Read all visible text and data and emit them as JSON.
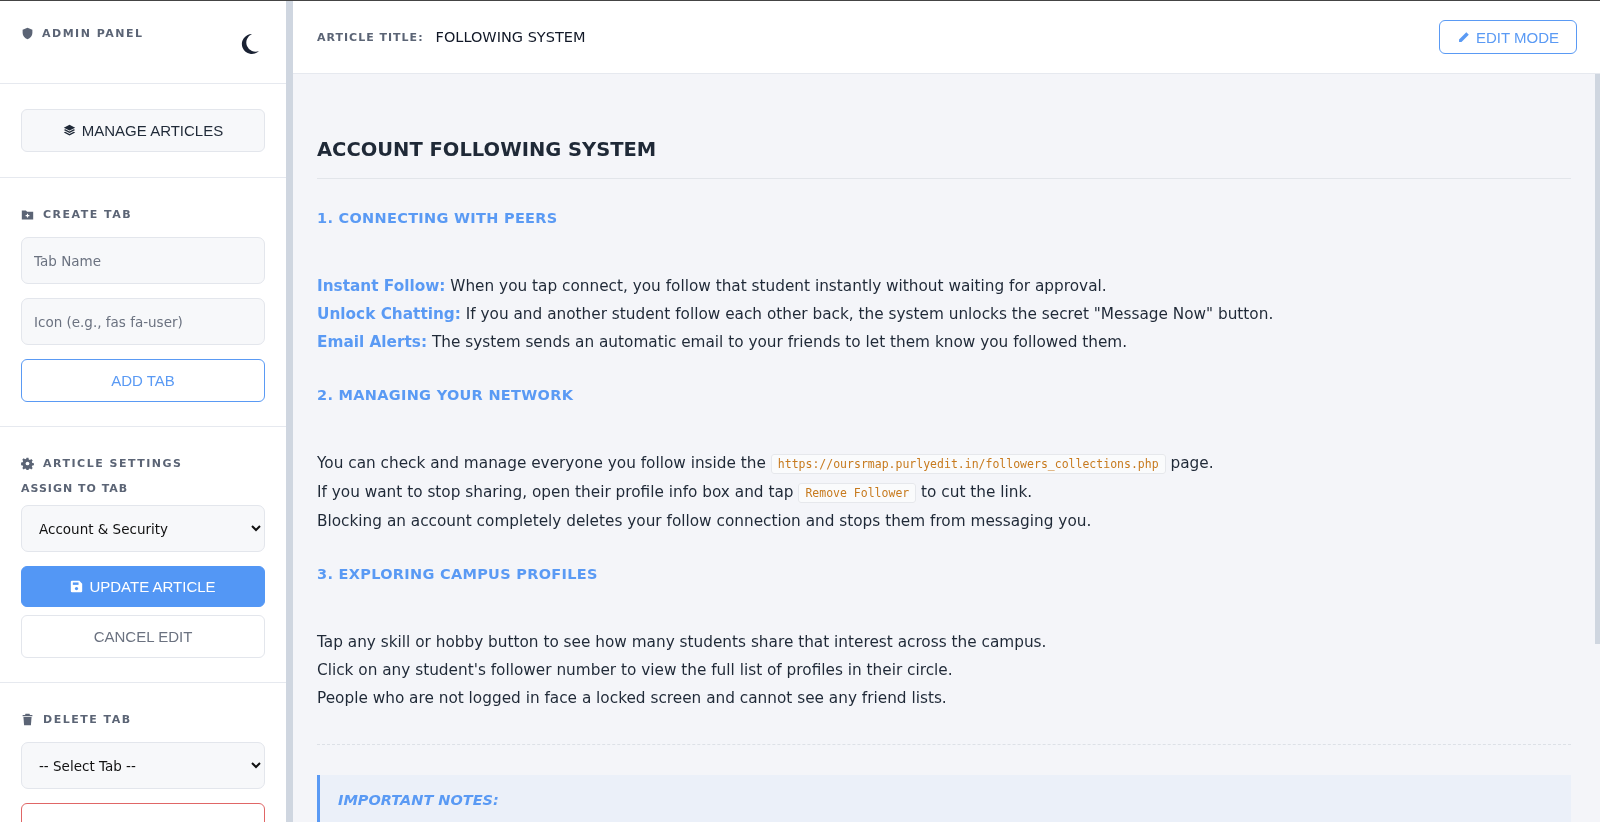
{
  "sidebar": {
    "brand": "ADMIN PANEL",
    "manage_button": "MANAGE ARTICLES",
    "create_tab": {
      "title": "CREATE TAB",
      "fields": [
        {
          "placeholder": "Tab Name"
        },
        {
          "placeholder": "Icon (e.g., fas fa-user)"
        }
      ],
      "button": "ADD TAB"
    },
    "article_settings": {
      "title": "ARTICLE SETTINGS",
      "assign_label": "ASSIGN TO TAB",
      "select_value": "Account & Security",
      "update_button": "UPDATE ARTICLE",
      "cancel_button": "CANCEL EDIT"
    },
    "delete_tab": {
      "title": "DELETE TAB",
      "select_value": "-- Select Tab --"
    }
  },
  "header": {
    "title_label": "ARTICLE TITLE:",
    "title_value": "FOLLOWING SYSTEM",
    "edit_button": "EDIT MODE"
  },
  "article": {
    "title": "ACCOUNT FOLLOWING SYSTEM",
    "sections": [
      {
        "heading": "1. CONNECTING WITH PEERS",
        "lines": [
          [
            {
              "kind": "lead",
              "text": "Instant Follow:"
            },
            {
              "kind": "text",
              "text": " When you tap connect, you follow that student instantly without waiting for approval."
            }
          ],
          [
            {
              "kind": "lead",
              "text": "Unlock Chatting:"
            },
            {
              "kind": "text",
              "text": " If you and another student follow each other back, the system unlocks the secret \"Message Now\" button."
            }
          ],
          [
            {
              "kind": "lead",
              "text": "Email Alerts:"
            },
            {
              "kind": "text",
              "text": " The system sends an automatic email to your friends to let them know you followed them."
            }
          ]
        ]
      },
      {
        "heading": "2. MANAGING YOUR NETWORK",
        "lines": [
          [
            {
              "kind": "text",
              "text": "You can check and manage everyone you follow inside the "
            },
            {
              "kind": "code",
              "text": "https://oursrmap.purlyedit.in/followers_collections.php"
            },
            {
              "kind": "text",
              "text": " page."
            }
          ],
          [
            {
              "kind": "text",
              "text": "If you want to stop sharing, open their profile info box and tap "
            },
            {
              "kind": "code",
              "text": "Remove Follower"
            },
            {
              "kind": "text",
              "text": " to cut the link."
            }
          ],
          [
            {
              "kind": "text",
              "text": "Blocking an account completely deletes your follow connection and stops them from messaging you."
            }
          ]
        ]
      },
      {
        "heading": "3. EXPLORING CAMPUS PROFILES",
        "lines": [
          [
            {
              "kind": "text",
              "text": "Tap any skill or hobby button to see how many students share that interest across the campus."
            }
          ],
          [
            {
              "kind": "text",
              "text": "Click on any student's follower number to view the full list of profiles in their circle."
            }
          ],
          [
            {
              "kind": "text",
              "text": "People who are not logged in face a locked screen and cannot see any friend lists."
            }
          ]
        ]
      }
    ],
    "notes": {
      "heading": "IMPORTANT NOTES:"
    }
  }
}
